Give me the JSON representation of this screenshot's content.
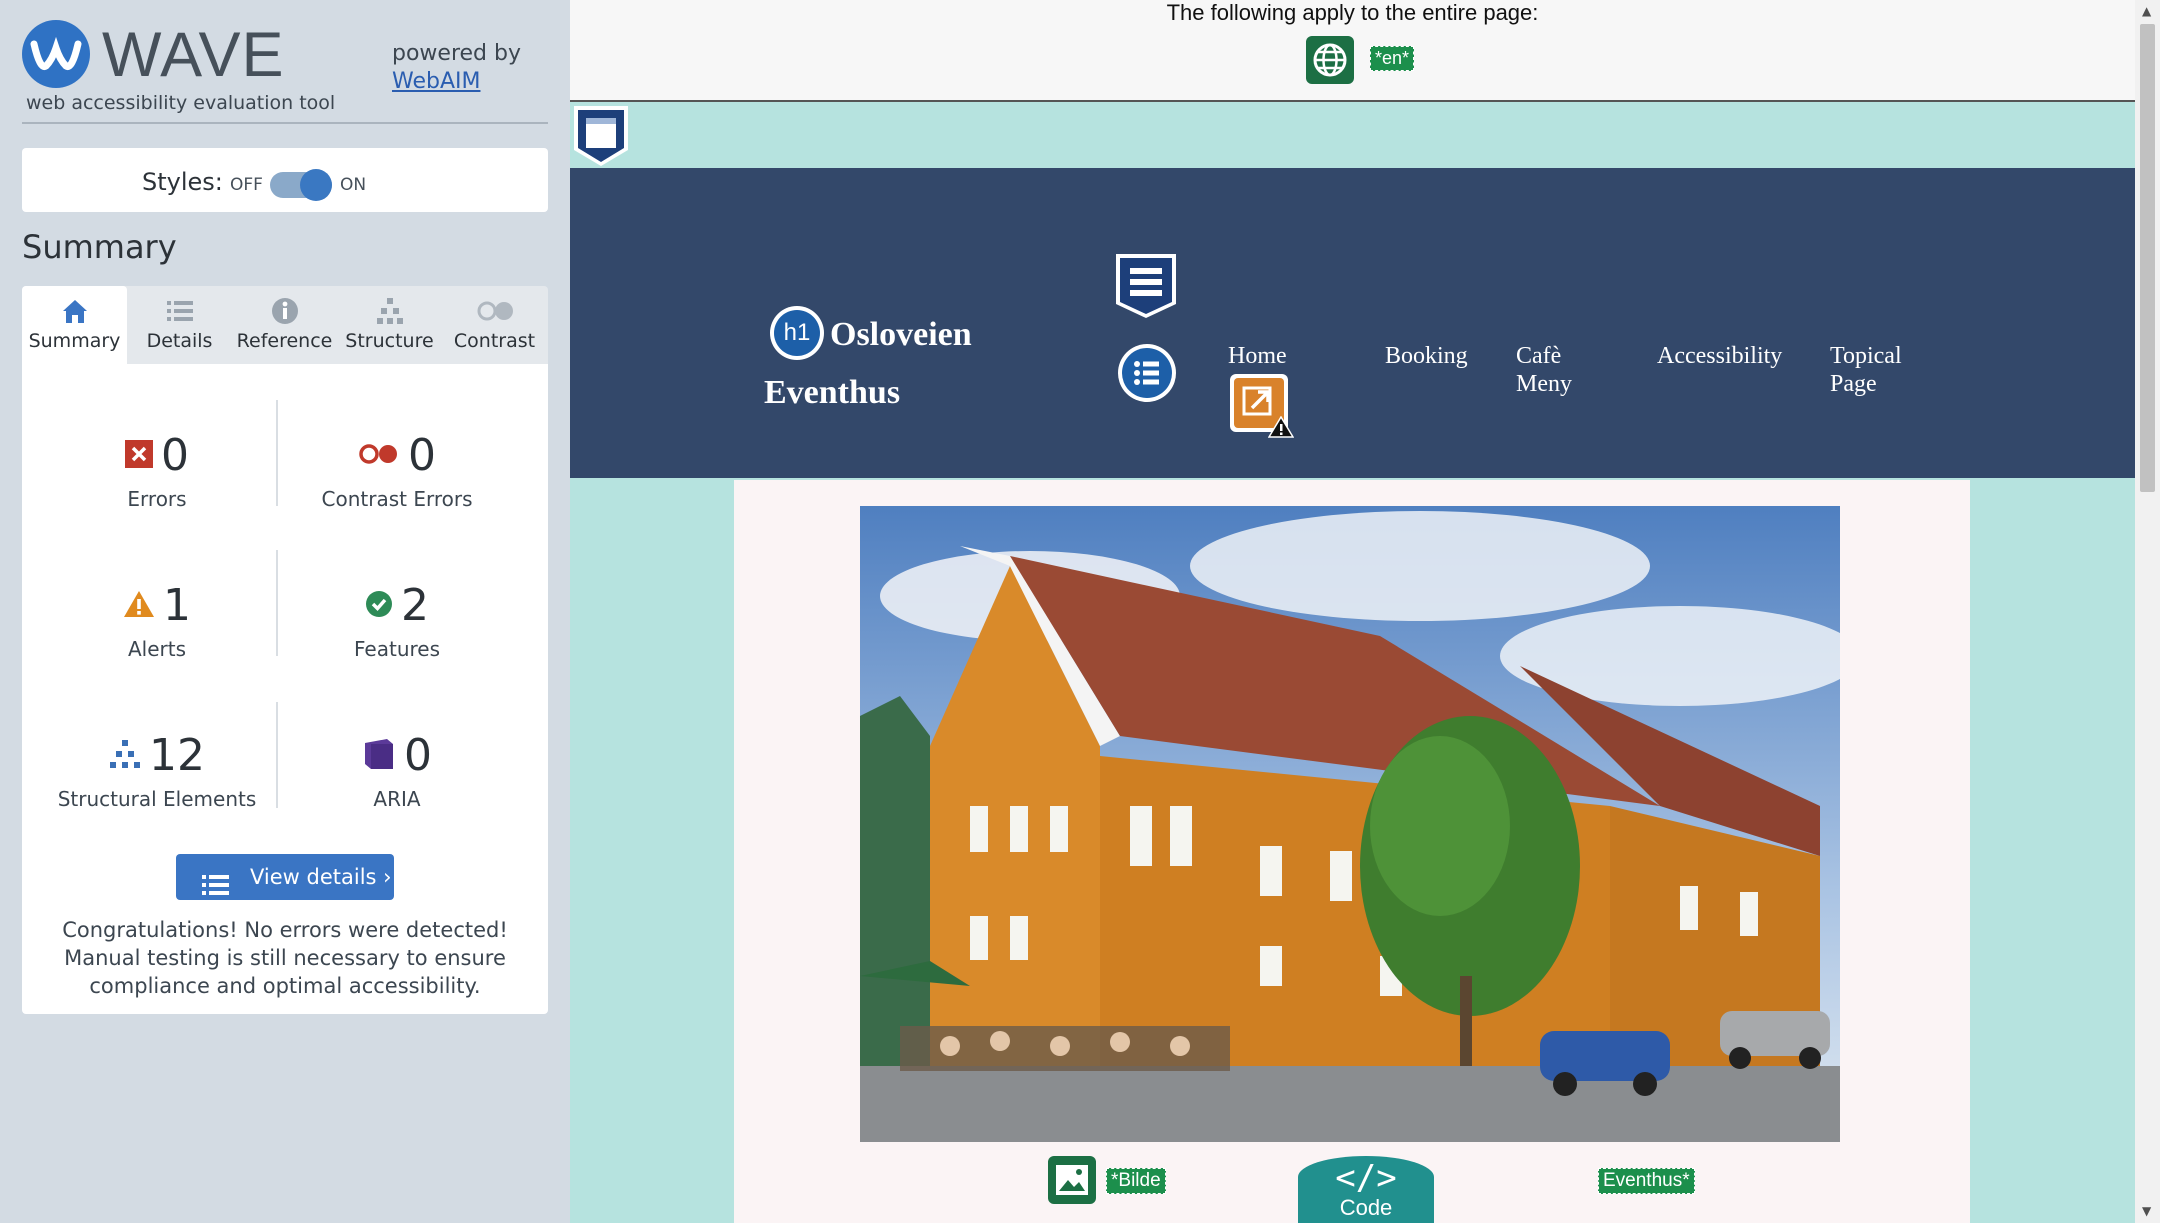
{
  "wave": {
    "logo_text": "WAVE",
    "subtitle": "web accessibility evaluation tool",
    "powered_by": "powered by",
    "webaim_link": "WebAIM",
    "styles_label": "Styles:",
    "styles_off": "OFF",
    "styles_on": "ON",
    "styles_state": "on",
    "summary_title": "Summary",
    "tabs": [
      {
        "label": "Summary",
        "icon": "home-icon",
        "active": true
      },
      {
        "label": "Details",
        "icon": "list-icon",
        "active": false
      },
      {
        "label": "Reference",
        "icon": "info-icon",
        "active": false
      },
      {
        "label": "Structure",
        "icon": "structure-icon",
        "active": false
      },
      {
        "label": "Contrast",
        "icon": "contrast-icon",
        "active": false
      }
    ],
    "stats": {
      "errors": {
        "count": "0",
        "label": "Errors"
      },
      "contrast_errors": {
        "count": "0",
        "label": "Contrast Errors"
      },
      "alerts": {
        "count": "1",
        "label": "Alerts"
      },
      "features": {
        "count": "2",
        "label": "Features"
      },
      "structural": {
        "count": "12",
        "label": "Structural Elements"
      },
      "aria": {
        "count": "0",
        "label": "ARIA"
      }
    },
    "view_details": "View details ›",
    "congrats": "Congratulations! No errors were detected! Manual testing is still necessary to ensure compliance and optimal accessibility."
  },
  "page": {
    "apply_text": "The following apply to the entire page:",
    "lang_badge": "*en*",
    "h1_badge": "h1",
    "site_title": "Osloveien Eventhus",
    "nav": [
      "Home",
      "Booking",
      "Cafè Meny",
      "Accessibility",
      "Topical Page"
    ],
    "alt_badge_left": "*Bilde",
    "alt_badge_right": "Eventhus*",
    "code_label": "Code",
    "code_icon": "</>"
  },
  "colors": {
    "sidebar_bg": "#d3dbe3",
    "page_bg": "#b6e3df",
    "header_bg": "#33486a",
    "wave_blue": "#3a75c4",
    "feature_green": "#1c8f4c",
    "alert_orange": "#d9822b",
    "code_teal": "#21908e"
  }
}
